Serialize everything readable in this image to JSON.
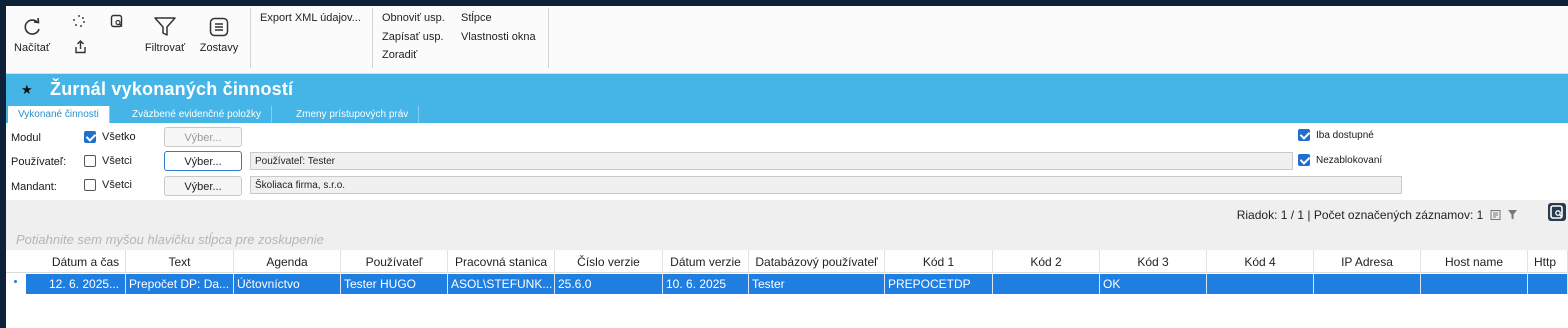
{
  "ribbon": {
    "load_label": "Načítať",
    "filter_label": "Filtrovať",
    "reports_label": "Zostavy",
    "export_label": "Export XML údajov...",
    "restore_label": "Obnoviť usp.",
    "save_label": "Zapísať usp.",
    "sort_label": "Zoradiť",
    "columns_label": "Stĺpce",
    "window_props_label": "Vlastnosti okna"
  },
  "title": "Žurnál vykonaných činností",
  "tabs": [
    {
      "label": "Vykonané činnosti",
      "active": true
    },
    {
      "label": "Zväzbené evidenčné položky",
      "active": false
    },
    {
      "label": "Zmeny prístupových práv",
      "active": false
    }
  ],
  "filters": {
    "module_label": "Modul",
    "module_all_label": "Všetko",
    "module_all_checked": true,
    "module_select_label": "Výber...",
    "user_label": "Používateľ:",
    "user_all_label": "Všetci",
    "user_all_checked": false,
    "user_select_label": "Výber...",
    "user_value": "Používateľ: Tester",
    "mandant_label": "Mandant:",
    "mandant_all_label": "Všetci",
    "mandant_all_checked": false,
    "mandant_select_label": "Výber...",
    "mandant_value": "Školiaca firma, s.r.o.",
    "only_available_label": "Iba dostupné",
    "only_available_checked": true,
    "unblocked_label": "Nezablokovaní",
    "unblocked_checked": true
  },
  "status": {
    "text": "Riadok: 1 / 1 | Počet označených záznamov: 1",
    "group_hint": "Potiahnite sem myšou hlavičku stĺpca pre zoskupenie"
  },
  "grid": {
    "headers": [
      "Dátum a čas",
      "Text",
      "Agenda",
      "Používateľ",
      "Pracovná stanica",
      "Číslo verzie",
      "Dátum verzie",
      "Databázový používateľ",
      "Kód 1",
      "Kód 2",
      "Kód 3",
      "Kód 4",
      "IP Adresa",
      "Host name",
      "Http"
    ],
    "rows": [
      [
        "12. 6. 2025...",
        "Prepočet DP: Da...",
        "Účtovníctvo",
        "Tester HUGO",
        "ASOL\\STEFUNK...",
        "25.6.0",
        "10. 6. 2025",
        "Tester",
        "PREPOCETDP",
        "",
        "OK",
        "",
        "",
        "",
        ""
      ]
    ]
  },
  "colors": {
    "title_bar": "#45b4e6",
    "selection": "#1e7fe0",
    "checkbox": "#1f6fcf"
  }
}
